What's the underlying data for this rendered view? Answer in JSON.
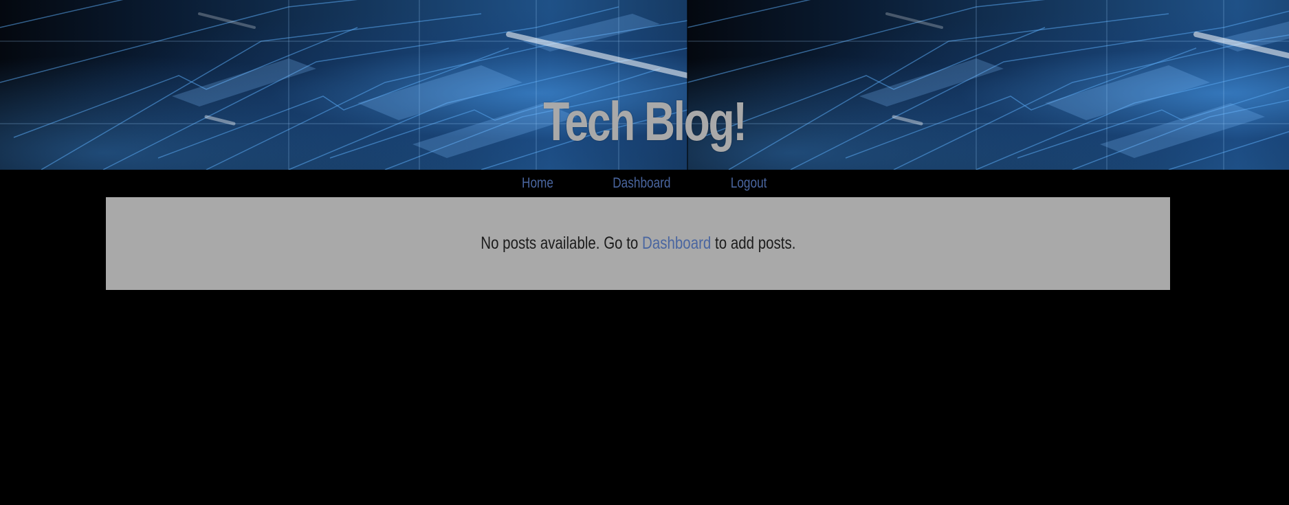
{
  "header": {
    "title": "Tech Blog!"
  },
  "nav": {
    "items": [
      {
        "label": "Home"
      },
      {
        "label": "Dashboard"
      },
      {
        "label": "Logout"
      }
    ]
  },
  "main": {
    "message_prefix": "No posts available. Go to ",
    "message_link": "Dashboard",
    "message_suffix": " to add posts."
  },
  "colors": {
    "page_background": "#000000",
    "card_background": "#a9a9a9",
    "link": "#4a66a0",
    "title": "#a9a9a9",
    "body_text": "#1c1c1c"
  }
}
